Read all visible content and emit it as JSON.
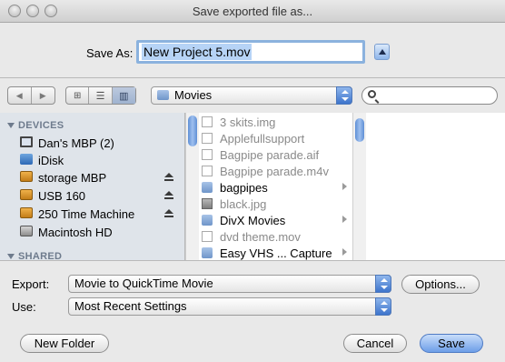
{
  "window": {
    "title": "Save exported file as..."
  },
  "save_as": {
    "label": "Save As:",
    "value": "New Project 5.mov"
  },
  "location": {
    "value": "Movies"
  },
  "sidebar": {
    "devices_header": "DEVICES",
    "shared_header": "SHARED",
    "items": [
      {
        "label": "Dan's MBP (2)",
        "icon": "laptop-icon"
      },
      {
        "label": "iDisk",
        "icon": "idisk-icon"
      },
      {
        "label": "storage MBP",
        "icon": "external-drive-icon"
      },
      {
        "label": "USB 160",
        "icon": "external-drive-icon"
      },
      {
        "label": "250 Time Machine",
        "icon": "external-drive-icon"
      },
      {
        "label": "Macintosh HD",
        "icon": "hard-drive-icon"
      }
    ]
  },
  "files": [
    {
      "label": "3 skits.img",
      "icon": "document-icon"
    },
    {
      "label": "Applefullsupport",
      "icon": "document-icon"
    },
    {
      "label": "Bagpipe parade.aif",
      "icon": "music-file-icon"
    },
    {
      "label": "Bagpipe parade.m4v",
      "icon": "music-file-icon"
    },
    {
      "label": "bagpipes",
      "icon": "folder-icon"
    },
    {
      "label": "black.jpg",
      "icon": "image-file-icon"
    },
    {
      "label": "DivX Movies",
      "icon": "folder-icon"
    },
    {
      "label": "dvd theme.mov",
      "icon": "document-icon"
    },
    {
      "label": "Easy VHS ... Capture",
      "icon": "folder-icon"
    }
  ],
  "options": {
    "export_label": "Export:",
    "export_value": "Movie to QuickTime Movie",
    "use_label": "Use:",
    "use_value": "Most Recent Settings",
    "options_button": "Options..."
  },
  "buttons": {
    "new_folder": "New Folder",
    "cancel": "Cancel",
    "save": "Save"
  }
}
